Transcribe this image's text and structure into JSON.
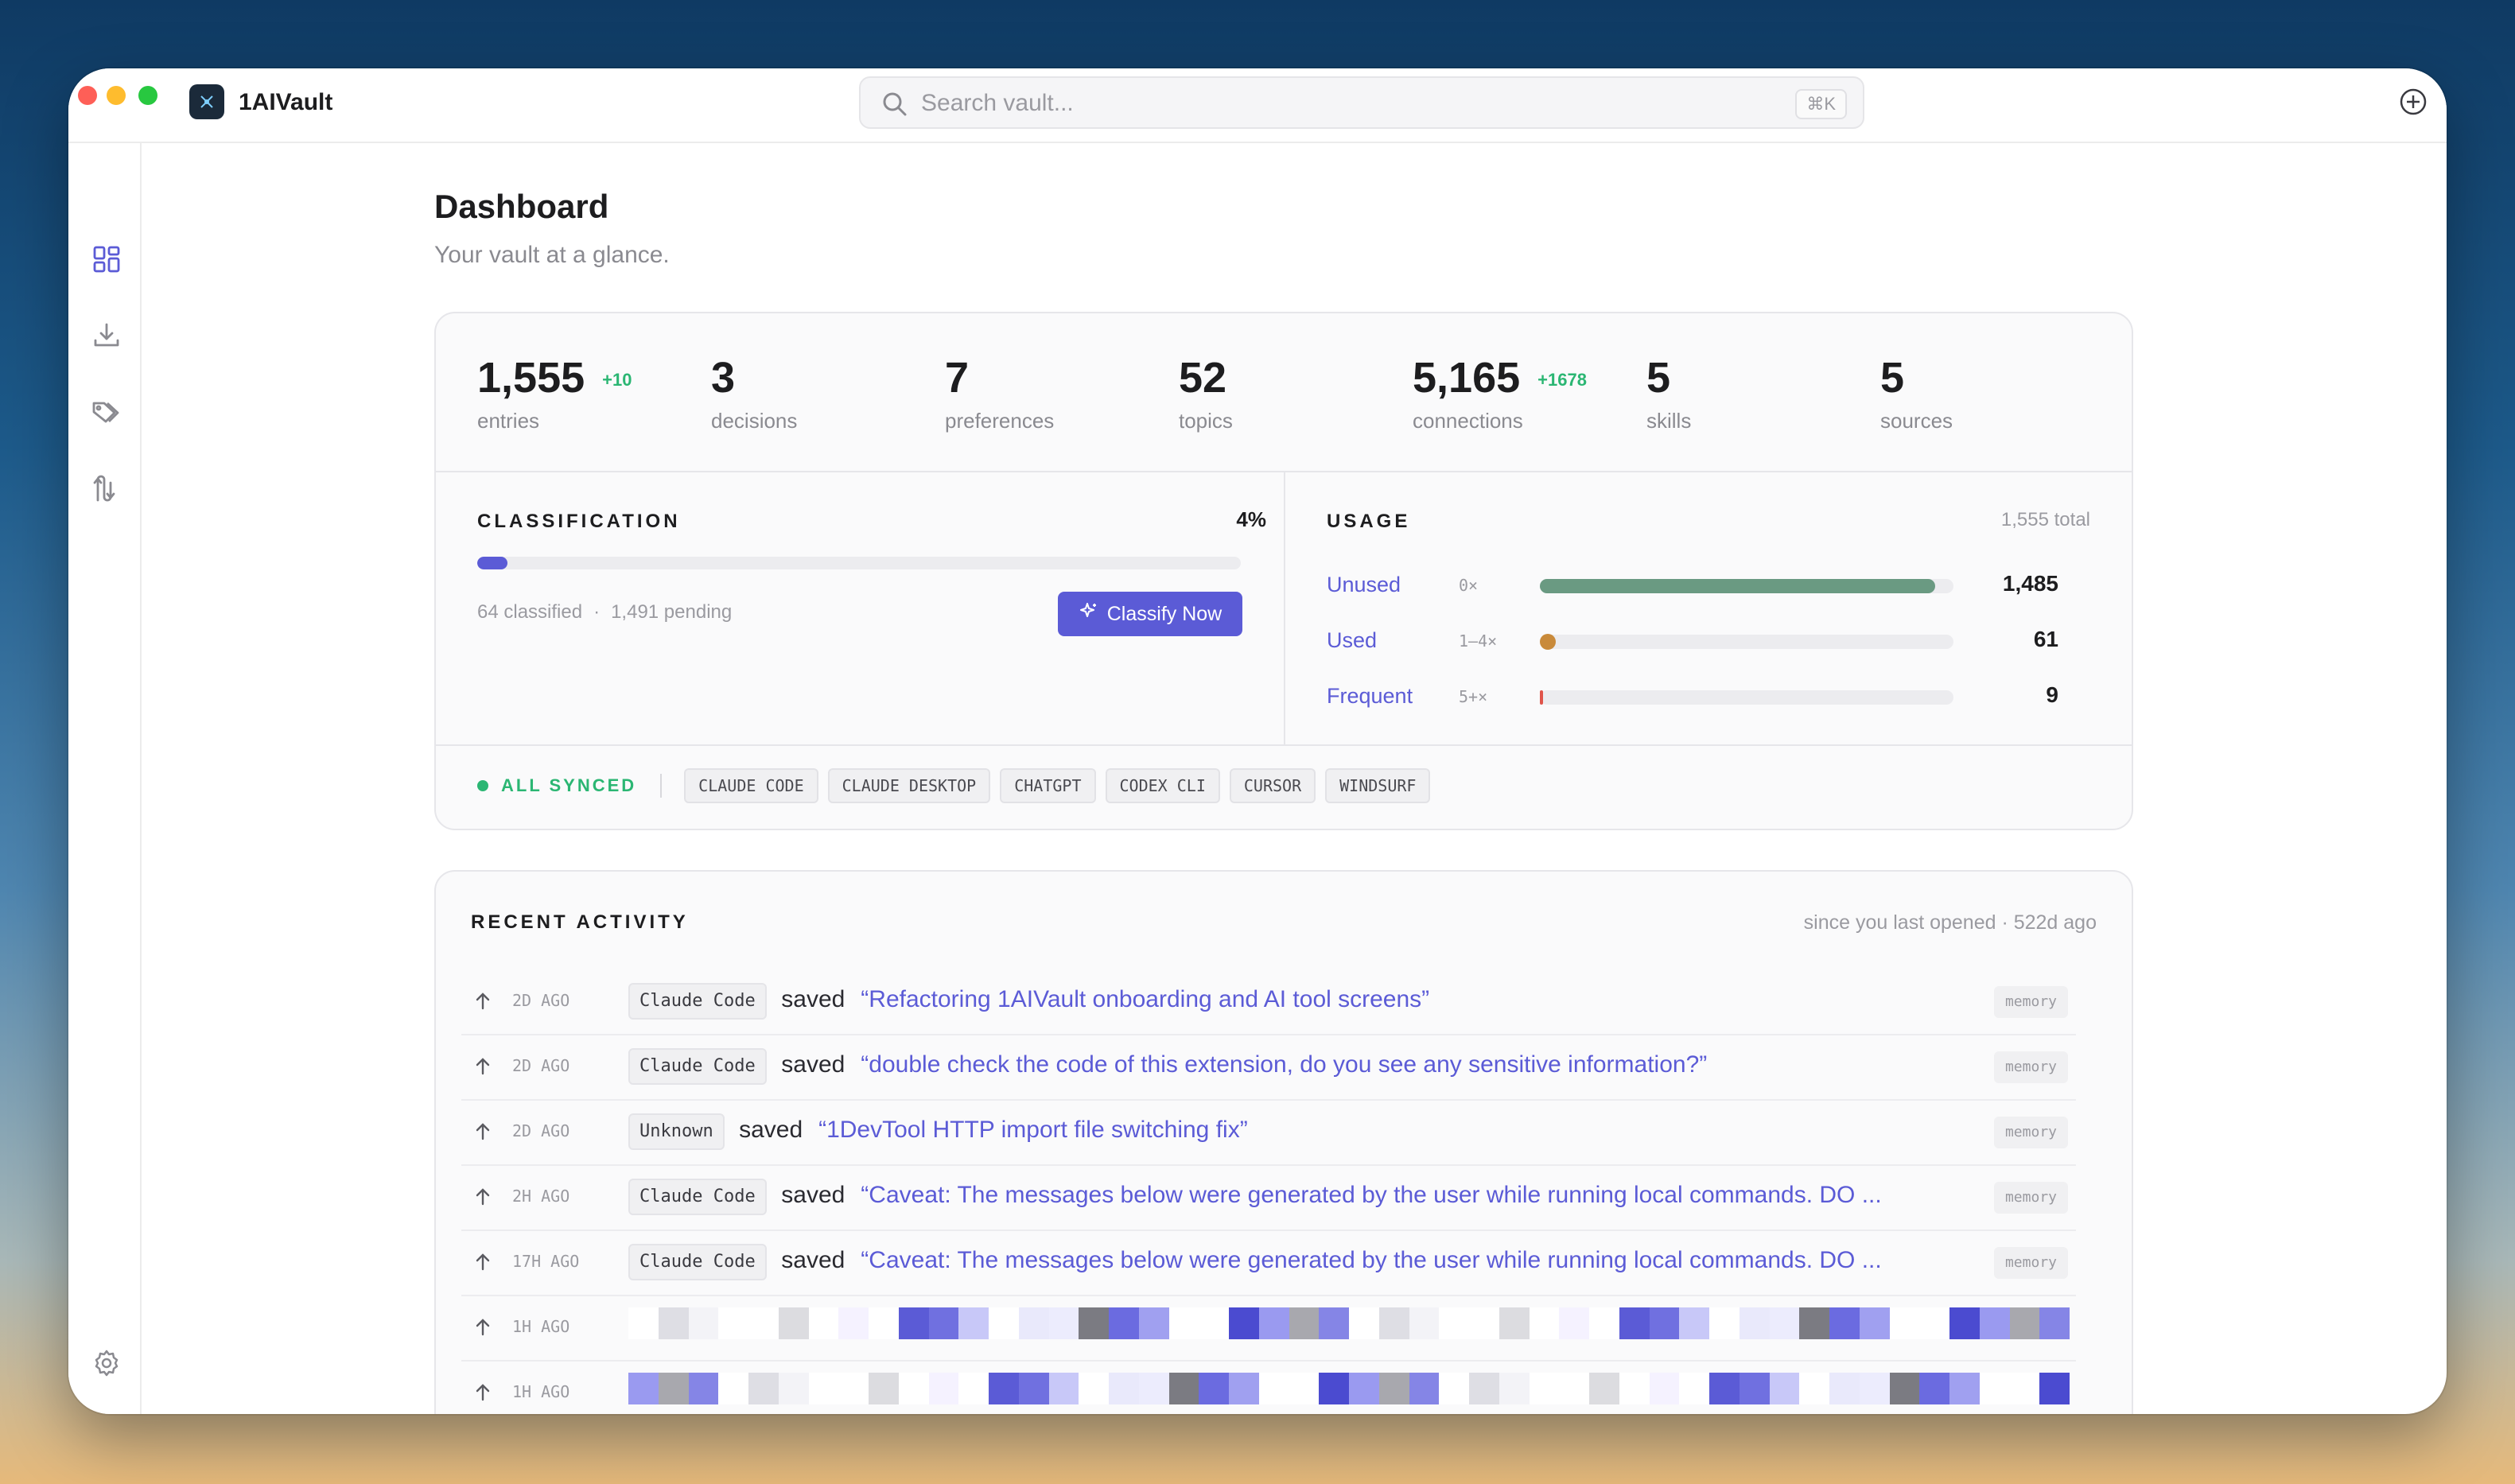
{
  "app": {
    "name": "1AIVault"
  },
  "search": {
    "placeholder": "Search vault...",
    "shortcut": "⌘K"
  },
  "sidebar": {
    "items": [
      {
        "name": "dashboard",
        "icon": "grid-icon",
        "active": true
      },
      {
        "name": "import",
        "icon": "download-icon"
      },
      {
        "name": "tags",
        "icon": "tags-icon"
      },
      {
        "name": "routes",
        "icon": "route-icon"
      }
    ],
    "settings_icon": "gear-icon"
  },
  "page": {
    "title": "Dashboard",
    "subtitle": "Your vault at a glance."
  },
  "stats": [
    {
      "value": "1,555",
      "delta": "+10",
      "label": "entries"
    },
    {
      "value": "3",
      "delta": "",
      "label": "decisions"
    },
    {
      "value": "7",
      "delta": "",
      "label": "preferences"
    },
    {
      "value": "52",
      "delta": "",
      "label": "topics"
    },
    {
      "value": "5,165",
      "delta": "+1678",
      "label": "connections"
    },
    {
      "value": "5",
      "delta": "",
      "label": "skills"
    },
    {
      "value": "5",
      "delta": "",
      "label": "sources"
    }
  ],
  "classification": {
    "title": "CLASSIFICATION",
    "percent_label": "4%",
    "percent": 0.04,
    "classified": "64 classified",
    "separator": "·",
    "pending": "1,491 pending",
    "button": "Classify Now"
  },
  "usage": {
    "title": "USAGE",
    "total": "1,555 total",
    "rows": [
      {
        "name": "Unused",
        "range": "0×",
        "value": "1,485",
        "fraction": 0.955,
        "color": "#6a9a82"
      },
      {
        "name": "Used",
        "range": "1–4×",
        "value": "61",
        "fraction": 0.039,
        "color": "#c98a3a"
      },
      {
        "name": "Frequent",
        "range": "5+×",
        "value": "9",
        "fraction": 0.006,
        "color": "#e0544a"
      }
    ]
  },
  "sync": {
    "status": "ALL SYNCED",
    "sources": [
      "CLAUDE CODE",
      "CLAUDE DESKTOP",
      "CHATGPT",
      "CODEX CLI",
      "CURSOR",
      "WINDSURF"
    ]
  },
  "activity": {
    "title": "RECENT ACTIVITY",
    "since": "since you last opened · 522d ago",
    "rows": [
      {
        "time": "2D AGO",
        "source": "Claude Code",
        "verb": "saved",
        "title": "“Refactoring 1AIVault onboarding and AI tool screens”",
        "type": "memory"
      },
      {
        "time": "2D AGO",
        "source": "Claude Code",
        "verb": "saved",
        "title": "“double check the code of this extension, do you see any sensitive information?”",
        "type": "memory"
      },
      {
        "time": "2D AGO",
        "source": "Unknown",
        "verb": "saved",
        "title": "“1DevTool HTTP import file switching fix”",
        "type": "memory"
      },
      {
        "time": "2H AGO",
        "source": "Claude Code",
        "verb": "saved",
        "title": "“Caveat: The messages below were generated by the user while running local commands. DO ...",
        "type": "memory"
      },
      {
        "time": "17H AGO",
        "source": "Claude Code",
        "verb": "saved",
        "title": "“Caveat: The messages below were generated by the user while running local commands. DO ...",
        "type": "memory"
      },
      {
        "time": "1H AGO",
        "redacted": true
      },
      {
        "time": "1H AGO",
        "redacted": true
      }
    ]
  },
  "colors": {
    "accent": "#5b5bd6",
    "success": "#2bb673"
  }
}
